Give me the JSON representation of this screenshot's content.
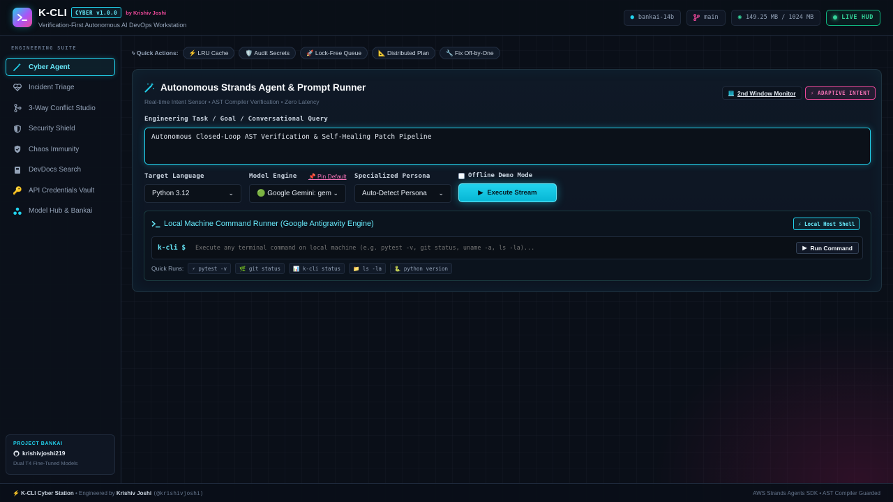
{
  "header": {
    "brand": "K-CLI",
    "version": "CYBER v1.0.0",
    "author": "by Krishiv Joshi",
    "subtitle": "Verification-First Autonomous AI DevOps Workstation",
    "model_chip": "bankai-14b",
    "branch_chip": "main",
    "memory_chip": "149.25 MB / 1024 MB",
    "live_chip": "LIVE HUD"
  },
  "sidebar": {
    "title": "ENGINEERING SUITE",
    "items": [
      {
        "label": "Cyber Agent",
        "icon": "wand-icon"
      },
      {
        "label": "Incident Triage",
        "icon": "heart-pulse-icon"
      },
      {
        "label": "3-Way Conflict Studio",
        "icon": "git-merge-icon"
      },
      {
        "label": "Security Shield",
        "icon": "shield-icon"
      },
      {
        "label": "Chaos Immunity",
        "icon": "shield-check-icon"
      },
      {
        "label": "DevDocs Search",
        "icon": "book-icon"
      },
      {
        "label": "API Credentials Vault",
        "icon": "key-icon"
      },
      {
        "label": "Model Hub & Bankai",
        "icon": "network-icon"
      }
    ],
    "project": {
      "title": "PROJECT BANKAI",
      "user": "krishivjoshi219",
      "sub": "Dual T4 Fine-Tuned Models"
    }
  },
  "quick_actions": {
    "label": "Quick Actions:",
    "items": [
      "LRU Cache",
      "Audit Secrets",
      "Lock-Free Queue",
      "Distributed Plan",
      "Fix Off-by-One"
    ]
  },
  "panel": {
    "title": "Autonomous Strands Agent & Prompt Runner",
    "subtitle": "Real-time Intent Sensor • AST Compiler Verification • Zero Latency",
    "monitor_button": "2nd Window Monitor",
    "intent_badge": "⚡ ADAPTIVE INTENT",
    "task_label": "Engineering Task / Goal / Conversational Query",
    "task_value": "Autonomous Closed-Loop AST Verification & Self-Healing Patch Pipeline",
    "language_label": "Target Language",
    "language_value": "Python 3.12",
    "model_label": "Model Engine",
    "pin_default": "📌 Pin Default",
    "model_value": "🟢 Google Gemini: gem",
    "persona_label": "Specialized Persona",
    "persona_value": "Auto-Detect Persona",
    "offline_label": "Offline Demo Mode",
    "execute_button": "Execute Stream"
  },
  "runner": {
    "title": "Local Machine Command Runner (Google Antigravity Engine)",
    "badge": "⚡ Local Host Shell",
    "prompt": "k-cli $",
    "placeholder": "Execute any terminal command on local machine (e.g. pytest -v, git status, uname -a, ls -la)...",
    "run_button": "Run Command",
    "quick_label": "Quick Runs:",
    "quick_runs": [
      "⚡ pytest -v",
      "🌿 git status",
      "📊 k-cli status",
      "📁 ls -la",
      "🐍 python version"
    ]
  },
  "footer": {
    "left_prefix": "⚡ K-CLI Cyber Station",
    "left_mid": "• Engineered by",
    "left_name": "Krishiv Joshi",
    "left_handle": "(@krishivjoshi)",
    "right": "AWS Strands Agents SDK • AST Compiler Guarded"
  },
  "colors": {
    "accent": "#22d3ee",
    "pink": "#ec4899",
    "live": "#34d399",
    "background": "#0a0f18"
  }
}
